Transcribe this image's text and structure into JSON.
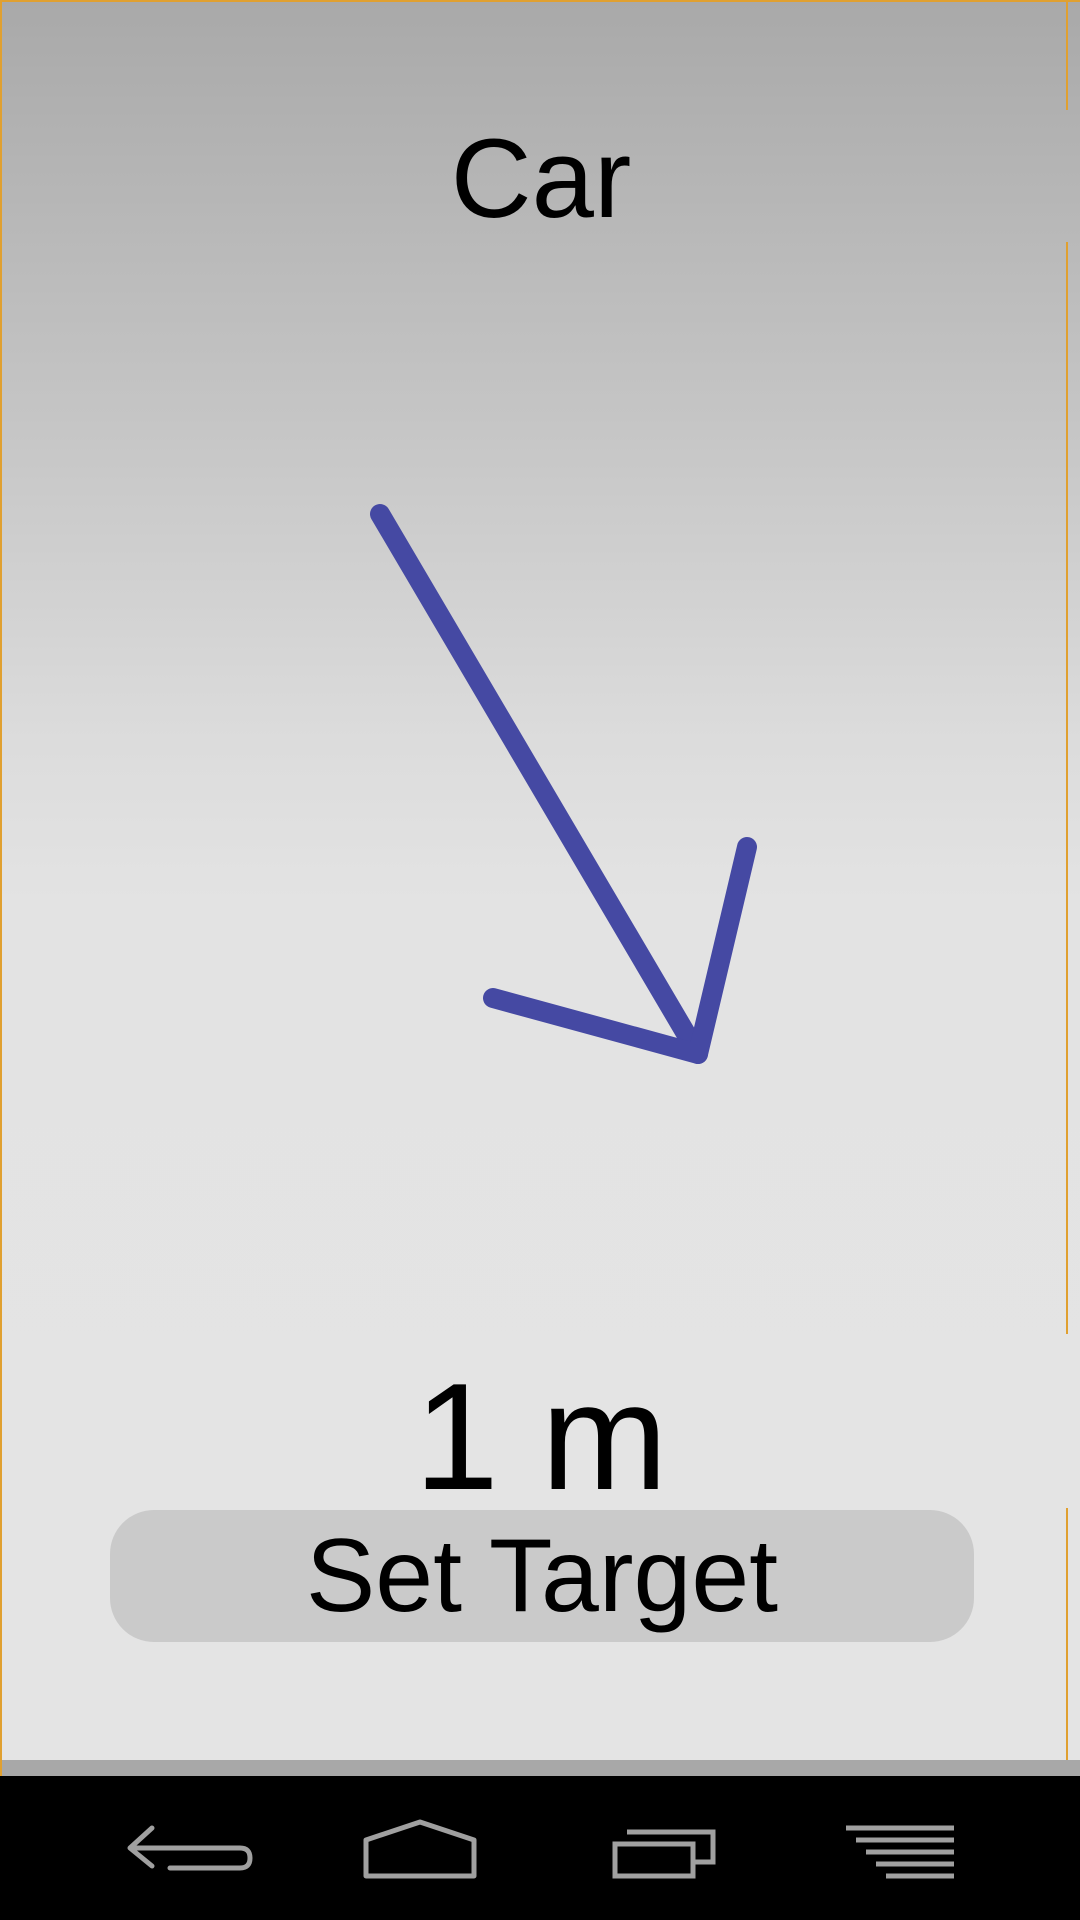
{
  "main": {
    "target_name": "Car",
    "distance": "1 m",
    "set_target_label": "Set Target",
    "arrow_color": "#4549a3",
    "arrow_direction": "south-east"
  },
  "navbar": {
    "icons": [
      "back-icon",
      "home-icon",
      "recent-apps-icon",
      "menu-icon"
    ]
  }
}
